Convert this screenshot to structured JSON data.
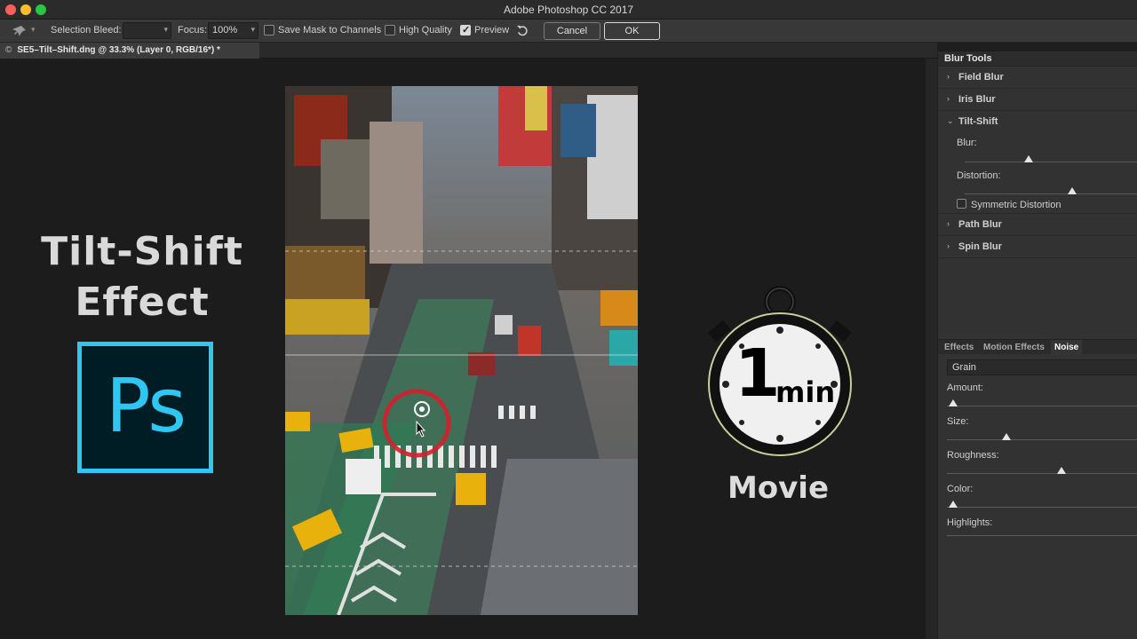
{
  "window": {
    "title": "Adobe Photoshop CC 2017"
  },
  "options_bar": {
    "selection_bleed_label": "Selection Bleed:",
    "selection_bleed_value": "",
    "focus_label": "Focus:",
    "focus_value": "100%",
    "save_mask_label": "Save Mask to Channels",
    "save_mask_checked": false,
    "high_quality_label": "High Quality",
    "high_quality_checked": false,
    "preview_label": "Preview",
    "preview_checked": true,
    "cancel_label": "Cancel",
    "ok_label": "OK"
  },
  "document_tab": {
    "close_glyph": "©",
    "title": "SE5–Tilt–Shift.dng @ 33.3% (Layer 0, RGB/16*) *"
  },
  "overlay": {
    "title_line1": "Tilt-Shift",
    "title_line2": "Effect",
    "ps_logo_text": "Ps",
    "stopwatch_number": "1",
    "stopwatch_unit": "min",
    "movie_label": "Movie"
  },
  "blur_panel": {
    "header": "Blur Tools",
    "sections": [
      {
        "name": "Field Blur",
        "expanded": false
      },
      {
        "name": "Iris Blur",
        "expanded": false
      },
      {
        "name": "Tilt-Shift",
        "expanded": true
      },
      {
        "name": "Path Blur",
        "expanded": false
      },
      {
        "name": "Spin Blur",
        "expanded": false
      }
    ],
    "tilt_shift": {
      "blur_label": "Blur:",
      "blur_level": 0.37,
      "distortion_label": "Distortion:",
      "distortion_level": 0.62,
      "symmetric_label": "Symmetric Distortion",
      "symmetric_checked": false
    }
  },
  "effects_panel": {
    "tabs": [
      "Effects",
      "Motion Effects",
      "Noise"
    ],
    "active_tab": "Noise",
    "preset": "Grain",
    "sliders": [
      {
        "label": "Amount:",
        "level": 0.0
      },
      {
        "label": "Size:",
        "level": 0.3
      },
      {
        "label": "Roughness:",
        "level": 0.61
      },
      {
        "label": "Color:",
        "level": 0.0
      },
      {
        "label": "Highlights:",
        "level": null
      }
    ]
  },
  "colors": {
    "ps_accent": "#2fc7f1",
    "ps_bg": "#001d26",
    "blur_pin": "#d2202e"
  }
}
